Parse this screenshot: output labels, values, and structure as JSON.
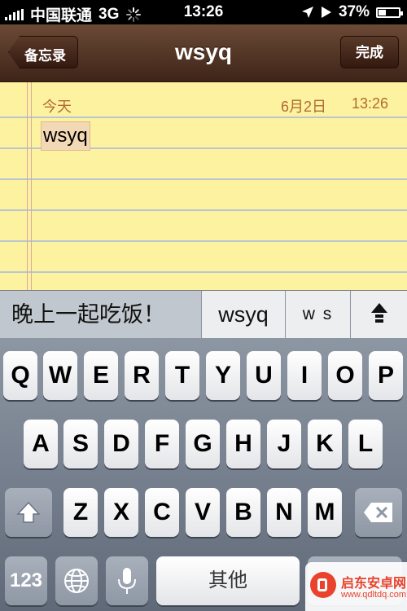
{
  "status_bar": {
    "carrier": "中国联通",
    "network": "3G",
    "time": "13:26",
    "battery": "37%",
    "battery_level": 0.37
  },
  "nav": {
    "back_label": "备忘录",
    "title": "wsyq",
    "done_label": "完成"
  },
  "note": {
    "day_label": "今天",
    "date": "6月2日",
    "time": "13:26",
    "text": "wsyq"
  },
  "suggestions": [
    "晚上一起吃饭！",
    "wsyq",
    "w s"
  ],
  "keyboard": {
    "row1": [
      "Q",
      "W",
      "E",
      "R",
      "T",
      "Y",
      "U",
      "I",
      "O",
      "P"
    ],
    "row2": [
      "A",
      "S",
      "D",
      "F",
      "G",
      "H",
      "J",
      "K",
      "L"
    ],
    "row3": [
      "Z",
      "X",
      "C",
      "V",
      "B",
      "N",
      "M"
    ],
    "numbers_label": "123",
    "space_label": "其他"
  },
  "watermark": {
    "title": "启东安卓网",
    "url": "www.qdltdq.com"
  },
  "colors": {
    "nav_brown": "#4f3222",
    "paper_yellow": "#fdf2a0",
    "date_orange": "#b06a32",
    "watermark_red": "#e9422d"
  }
}
